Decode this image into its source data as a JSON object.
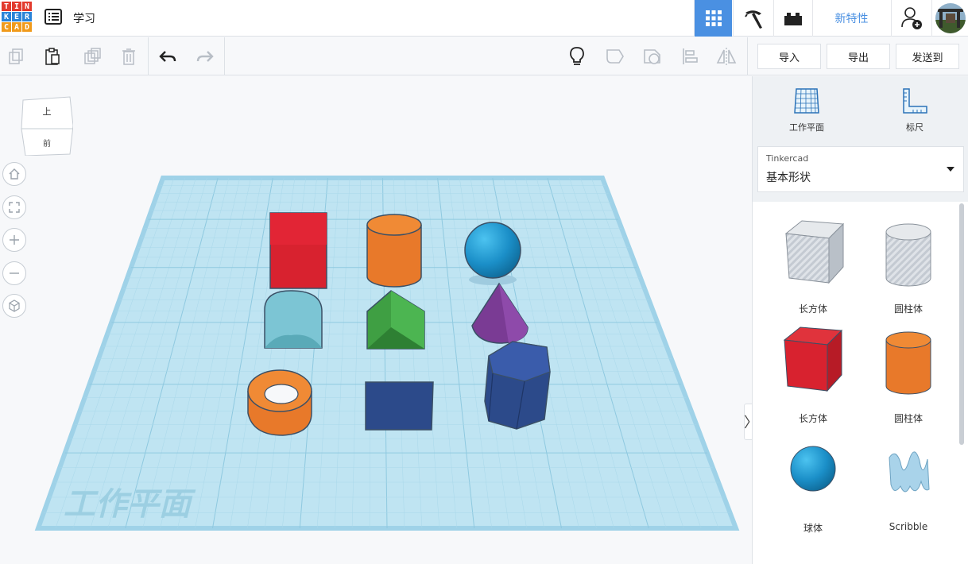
{
  "header": {
    "logo_letters": [
      "T",
      "I",
      "N",
      "K",
      "E",
      "R",
      "C",
      "A",
      "D"
    ],
    "logo_colors": [
      "#e23b2e",
      "#e23b2e",
      "#e23b2e",
      "#2b84d8",
      "#2b84d8",
      "#2b84d8",
      "#f09a1b",
      "#f09a1b",
      "#f09a1b"
    ],
    "app_title": "学习",
    "new_features_label": "新特性",
    "grid_view_color": "#4a90e2"
  },
  "toolbar": {
    "import_label": "导入",
    "export_label": "导出",
    "send_to_label": "发送到"
  },
  "viewcube": {
    "top_label": "上",
    "front_label": "前"
  },
  "workplane": {
    "label": "工作平面"
  },
  "panel": {
    "workplane_label": "工作平面",
    "ruler_label": "标尺",
    "library_source": "Tinkercad",
    "library_name": "基本形状",
    "shapes": [
      {
        "label": "长方体",
        "icon": "box-hole-icon"
      },
      {
        "label": "圆柱体",
        "icon": "cylinder-hole-icon"
      },
      {
        "label": "长方体",
        "icon": "box-icon"
      },
      {
        "label": "圆柱体",
        "icon": "cylinder-icon"
      },
      {
        "label": "球体",
        "icon": "sphere-icon"
      },
      {
        "label": "Scribble",
        "icon": "scribble-icon"
      }
    ]
  }
}
